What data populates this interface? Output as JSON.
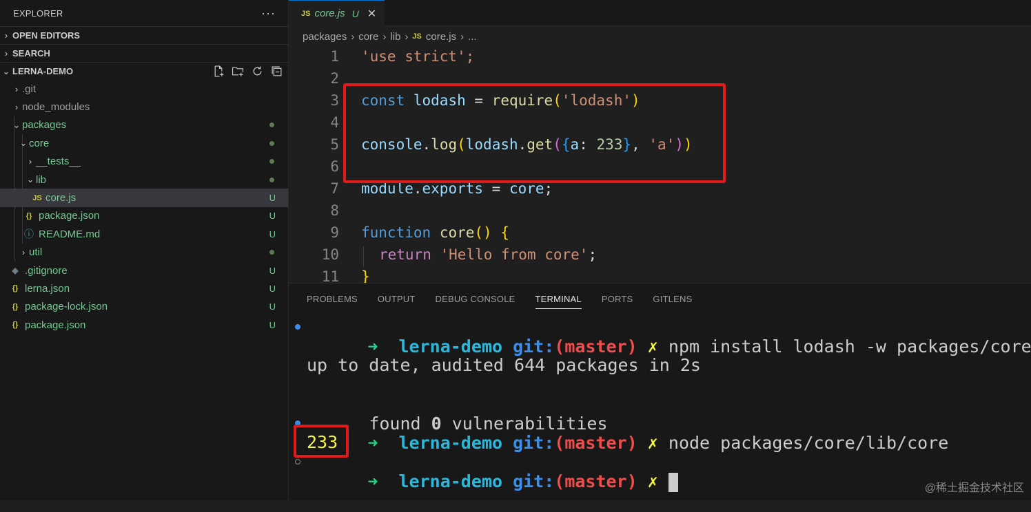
{
  "sidebar": {
    "title": "EXPLORER",
    "more": "···",
    "sections": {
      "open_editors": "OPEN EDITORS",
      "search": "SEARCH",
      "project": "LERNA-DEMO"
    },
    "tree": [
      {
        "label": ".git",
        "badge": ""
      },
      {
        "label": "node_modules",
        "badge": ""
      },
      {
        "label": "packages",
        "badge": ""
      },
      {
        "label": "core",
        "badge": ""
      },
      {
        "label": "__tests__",
        "badge": ""
      },
      {
        "label": "lib",
        "badge": ""
      },
      {
        "label": "core.js",
        "badge": "U",
        "icon": "JS"
      },
      {
        "label": "package.json",
        "badge": "U",
        "icon": "{}"
      },
      {
        "label": "README.md",
        "badge": "U",
        "icon": "ⓘ"
      },
      {
        "label": "util",
        "badge": ""
      },
      {
        "label": ".gitignore",
        "badge": "U",
        "icon": "◆"
      },
      {
        "label": "lerna.json",
        "badge": "U",
        "icon": "{}"
      },
      {
        "label": "package-lock.json",
        "badge": "U",
        "icon": "{}"
      },
      {
        "label": "package.json",
        "badge": "U",
        "icon": "{}"
      }
    ]
  },
  "editor": {
    "tab": {
      "icon": "JS",
      "name": "core.js",
      "status": "U",
      "close": "✕"
    },
    "breadcrumb": [
      "packages",
      "core",
      "lib",
      "core.js",
      "..."
    ],
    "breadcrumb_icon": "JS",
    "line_numbers": [
      "1",
      "2",
      "3",
      "4",
      "5",
      "6",
      "7",
      "8",
      "9",
      "10",
      "11"
    ],
    "code": {
      "l1": "'use strict';",
      "l3_kw": "const",
      "l3_var": "lodash",
      "l3_eq": " = ",
      "l3_fn": "require",
      "l3_str": "'lodash'",
      "l5_obj": "console",
      "l5_fn1": "log",
      "l5_var": "lodash",
      "l5_fn2": "get",
      "l5_key": "a",
      "l5_num": "233",
      "l5_str": "'a'",
      "l7_a": "module",
      "l7_b": "exports",
      "l7_c": "core",
      "l9_kw": "function",
      "l9_fn": "core",
      "l10_kw": "return",
      "l10_str": "'Hello from core'",
      "l11": "}"
    }
  },
  "panel": {
    "tabs": [
      "PROBLEMS",
      "OUTPUT",
      "DEBUG CONSOLE",
      "TERMINAL",
      "PORTS",
      "GITLENS"
    ],
    "active_tab": "TERMINAL",
    "terminal": {
      "prompt_arrow": "➜",
      "dir": "lerna-demo",
      "git": "git:",
      "branch": "(master)",
      "dirty": "✗",
      "cmd1": "npm install lodash -w packages/core",
      "out1": "up to date, audited 644 packages in 2s",
      "out2_a": "found ",
      "out2_num": "0",
      "out2_b": " vulnerabilities",
      "cmd2": "node packages/core/lib/core",
      "result": "233"
    }
  },
  "watermark": "@稀土掘金技术社区"
}
